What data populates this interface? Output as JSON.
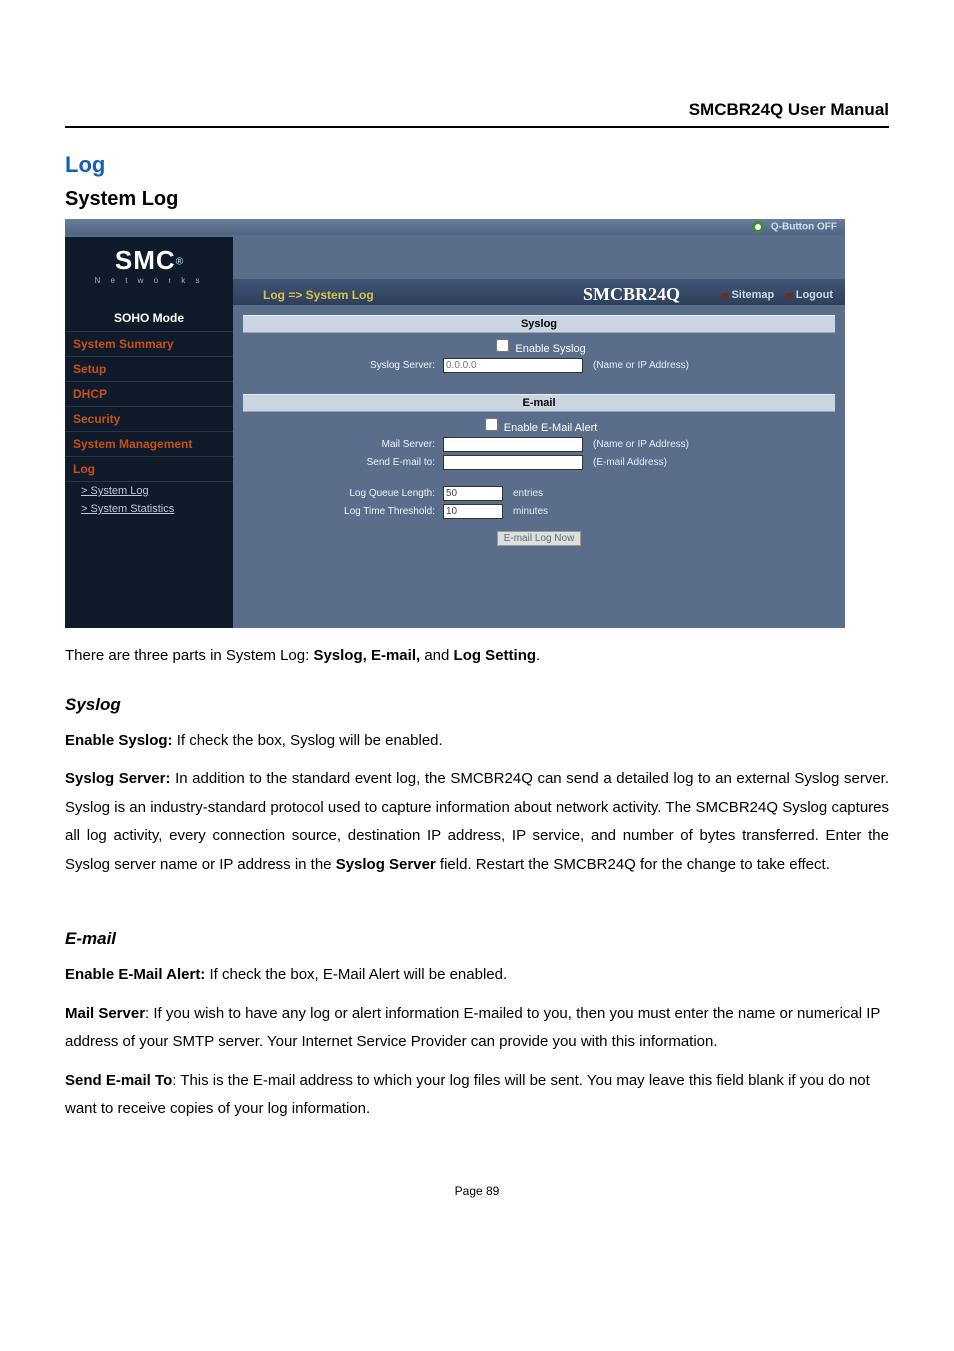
{
  "doc": {
    "manual_title": "SMCBR24Q User Manual",
    "h1": "Log",
    "h2": "System Log",
    "intro_pre": "There are three parts in System Log: ",
    "intro_bold": "Syslog, E-mail,",
    "intro_post": " and ",
    "intro_bold2": "Log Setting",
    "intro_period": ".",
    "syslog_h": "Syslog",
    "syslog_enable_b": "Enable Syslog:",
    "syslog_enable_t": " If check the box, Syslog will be enabled.",
    "syslog_server_b": "Syslog Server:",
    "syslog_server_t": " In addition to the standard event log, the SMCBR24Q can send a detailed log to an external Syslog server. Syslog is an industry-standard protocol used to capture information about network activity. The SMCBR24Q Syslog captures all log activity, every connection source, destination IP address, IP service, and number of bytes transferred. Enter the Syslog server name or IP address in the ",
    "syslog_server_b2": "Syslog Server",
    "syslog_server_t2": " field. Restart the SMCBR24Q for the change to take effect.",
    "email_h": "E-mail",
    "email_enable_b": "Enable E-Mail Alert:",
    "email_enable_t": " If check the box, E-Mail Alert will be enabled.",
    "email_mail_b": "Mail Server",
    "email_mail_t": ": If you wish to have any log or alert information E-mailed to you, then you must enter the name or numerical IP address of your SMTP server. Your Internet Service Provider can provide you with this information.",
    "email_send_b": "Send E-mail To",
    "email_send_t": ": This is the E-mail address to which your log files will be sent. You may leave this field blank if you do not want to receive copies of your log information.",
    "page_num": "Page 89"
  },
  "ui": {
    "qbtn": "Q-Button OFF",
    "logo_main": "SMC",
    "logo_sup": "®",
    "logo_sub": "N e t w o r k s",
    "breadcrumb": "Log => System Log",
    "product": "SMCBR24Q",
    "sitemap": "Sitemap",
    "logout": "Logout",
    "side_mode": "SOHO Mode",
    "side_items": {
      "summary": "System Summary",
      "setup": "Setup",
      "dhcp": "DHCP",
      "security": "Security",
      "sysmgmt": "System Management",
      "log": "Log",
      "syslog": "> System Log",
      "sysstats": "> System Statistics"
    },
    "syslog": {
      "title": "Syslog",
      "enable_lbl": "Enable Syslog",
      "server_lbl": "Syslog Server:",
      "server_placeholder": "0.0.0.0",
      "server_hint": "(Name or IP Address)"
    },
    "email": {
      "title": "E-mail",
      "enable_lbl": "Enable E-Mail Alert",
      "mail_lbl": "Mail Server:",
      "mail_hint": "(Name or IP Address)",
      "sendto_lbl": "Send E-mail to:",
      "sendto_hint": "(E-mail Address)",
      "queue_lbl": "Log Queue Length:",
      "queue_val": "50",
      "queue_hint": "entries",
      "thresh_lbl": "Log Time Threshold:",
      "thresh_val": "10",
      "thresh_hint": "minutes",
      "now_btn": "E-mail Log Now"
    }
  }
}
